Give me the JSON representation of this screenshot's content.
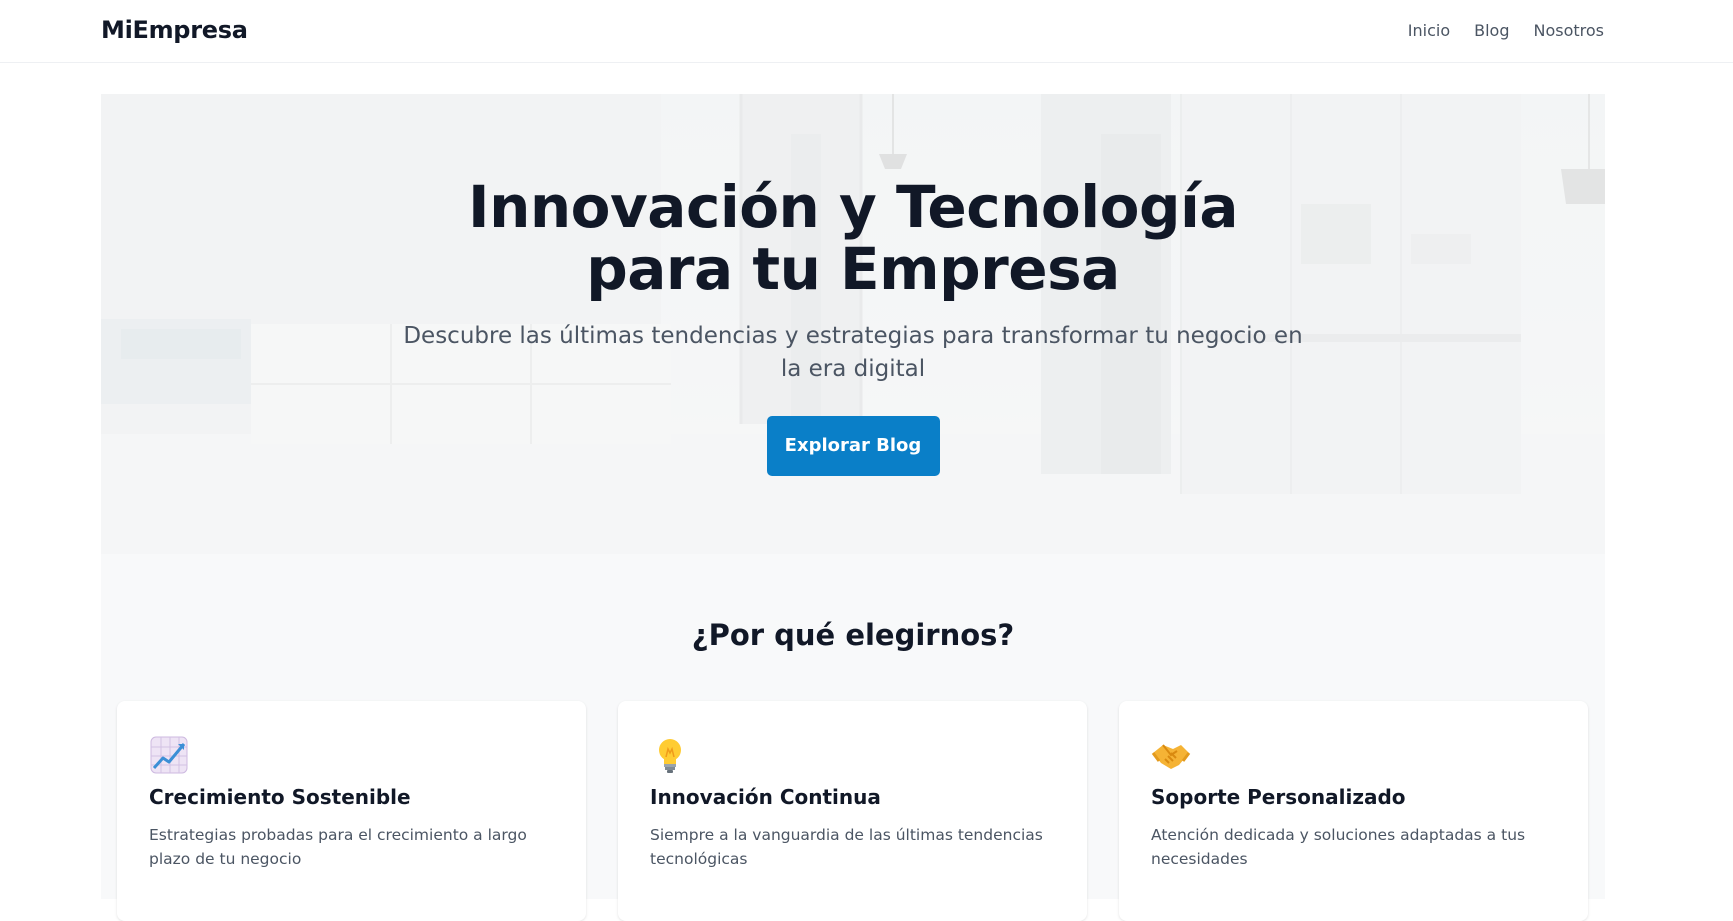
{
  "navbar": {
    "brand": "MiEmpresa",
    "links": [
      {
        "label": "Inicio"
      },
      {
        "label": "Blog"
      },
      {
        "label": "Nosotros"
      }
    ]
  },
  "hero": {
    "title": "Innovación y Tecnología para tu Empresa",
    "subtitle": "Descubre las últimas tendencias y estrategias para transformar tu negocio en la era digital",
    "cta_label": "Explorar Blog",
    "cta_color": "#0a7fc8"
  },
  "features": {
    "title": "¿Por qué elegirnos?",
    "cards": [
      {
        "icon": "chart-increasing-icon",
        "title": "Crecimiento Sostenible",
        "text": "Estrategias probadas para el crecimiento a largo plazo de tu negocio"
      },
      {
        "icon": "light-bulb-icon",
        "title": "Innovación Continua",
        "text": "Siempre a la vanguardia de las últimas tendencias tecnológicas"
      },
      {
        "icon": "handshake-icon",
        "title": "Soporte Personalizado",
        "text": "Atención dedicada y soluciones adaptadas a tus necesidades"
      }
    ]
  }
}
